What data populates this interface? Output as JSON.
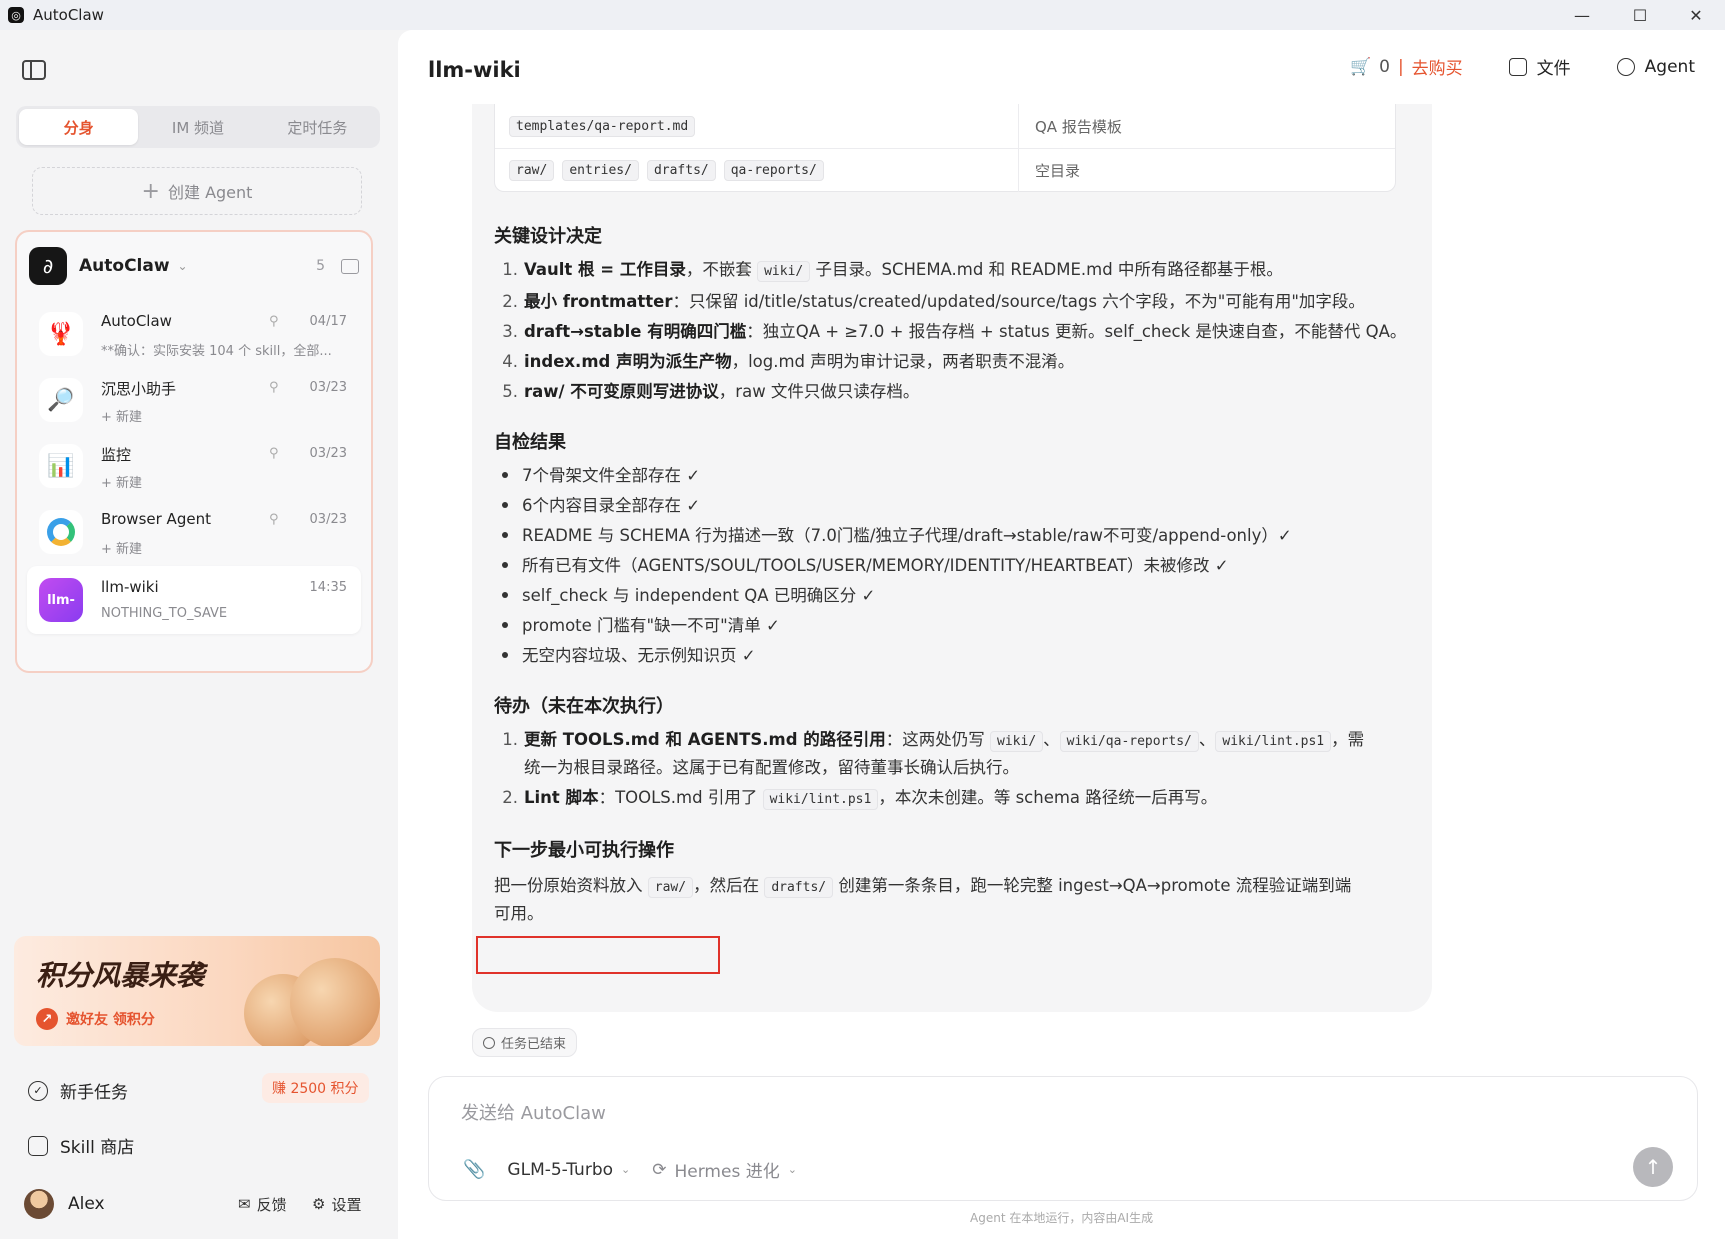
{
  "window": {
    "title": "AutoClaw",
    "minimize": "—",
    "maximize": "☐",
    "close": "✕"
  },
  "sidebar": {
    "tabs": [
      {
        "label": "分身",
        "active": true
      },
      {
        "label": "IM 频道",
        "active": false
      },
      {
        "label": "定时任务",
        "active": false
      }
    ],
    "create_agent": "创建 Agent",
    "group": {
      "name": "AutoClaw",
      "count": "5"
    },
    "agents": [
      {
        "name": "AutoClaw",
        "sub": "**确认：实际安装 104 个 skill，全部...",
        "date": "04/17",
        "pinned": true,
        "icon": "lobster-icon"
      },
      {
        "name": "沉思小助手",
        "sub": "+ 新建",
        "date": "03/23",
        "pinned": true,
        "icon": "magnifier-icon"
      },
      {
        "name": "监控",
        "sub": "+ 新建",
        "date": "03/23",
        "pinned": true,
        "icon": "chart-icon"
      },
      {
        "name": "Browser Agent",
        "sub": "+ 新建",
        "date": "03/23",
        "pinned": true,
        "icon": "browser-icon"
      },
      {
        "name": "llm-wiki",
        "sub": "NOTHING_TO_SAVE",
        "date": "14:35",
        "pinned": false,
        "avatar_text": "llm-"
      }
    ],
    "promo": {
      "title": "积分风暴来袭",
      "subtitle": "邀好友 领积分"
    },
    "links": {
      "novice": "新手任务",
      "earn": "赚 2500 积分",
      "skills": "Skill 商店"
    },
    "user": {
      "name": "Alex",
      "feedback": "反馈",
      "settings": "设置"
    }
  },
  "header": {
    "title": "llm-wiki",
    "cart_count": "0",
    "cart_sep": "|",
    "buy": "去购买",
    "files": "文件",
    "agent": "Agent"
  },
  "message": {
    "table": [
      {
        "codes": [
          "templates/qa-report.md"
        ],
        "desc": "QA 报告模板"
      },
      {
        "codes": [
          "raw/",
          "entries/",
          "drafts/",
          "qa-reports/"
        ],
        "desc": "空目录"
      }
    ],
    "design": {
      "heading": "关键设计决定",
      "items": [
        {
          "num": "1.",
          "bold": "Vault 根 = 工作目录",
          "pre": "，不嵌套 ",
          "code": "wiki/",
          "post": " 子目录。SCHEMA.md 和 README.md 中所有路径都基于根。"
        },
        {
          "num": "2.",
          "bold": "最小 frontmatter",
          "post": "：只保留 id/title/status/created/updated/source/tags 六个字段，不为\"可能有用\"加字段。"
        },
        {
          "num": "3.",
          "bold": "draft→stable 有明确四门槛",
          "post": "：独立QA + ≥7.0 + 报告存档 + status 更新。self_check 是快速自查，不能替代 QA。"
        },
        {
          "num": "4.",
          "bold": "index.md 声明为派生产物",
          "post": "，log.md 声明为审计记录，两者职责不混淆。"
        },
        {
          "num": "5.",
          "bold": "raw/ 不可变原则写进协议",
          "post": "，raw 文件只做只读存档。"
        }
      ]
    },
    "selfcheck": {
      "heading": "自检结果",
      "items": [
        "7个骨架文件全部存在 ✓",
        "6个内容目录全部存在 ✓",
        "README 与 SCHEMA 行为描述一致（7.0门槛/独立子代理/draft→stable/raw不可变/append-only）✓",
        "所有已有文件（AGENTS/SOUL/TOOLS/USER/MEMORY/IDENTITY/HEARTBEAT）未被修改 ✓",
        "self_check 与 independent QA 已明确区分 ✓",
        "promote 门槛有\"缺一不可\"清单 ✓",
        "无空内容垃圾、无示例知识页 ✓"
      ]
    },
    "todo": {
      "heading": "待办（未在本次执行）",
      "item1": {
        "num": "1.",
        "bold": "更新 TOOLS.md 和 AGENTS.md 的路径引用",
        "pre": "：这两处仍写 ",
        "codes": [
          "wiki/",
          "wiki/qa-reports/",
          "wiki/lint.ps1"
        ],
        "sep": "、",
        "post": "，需",
        "cont": "统一为根目录路径。这属于已有配置修改，留待董事长确认后执行。"
      },
      "item2": {
        "num": "2.",
        "bold": "Lint 脚本",
        "pre": "：TOOLS.md 引用了 ",
        "code": "wiki/lint.ps1",
        "post": "，本次未创建。等 schema 路径统一后再写。"
      }
    },
    "next": {
      "heading": "下一步最小可执行操作",
      "pre": "把一份原始资料放入 ",
      "code1": "raw/",
      "mid": "，然后在 ",
      "code2": "drafts/",
      "post": " 创建第一条条目，跑一轮完整 ingest→QA→promote 流程验证端到端",
      "cont": "可用。"
    },
    "status": "任务已结束"
  },
  "composer": {
    "placeholder": "发送给 AutoClaw",
    "model": "GLM-5-Turbo",
    "mode": "Hermes 进化",
    "footer": "Agent 在本地运行，内容由AI生成"
  },
  "colors": {
    "accent": "#e5542f",
    "highlight_border": "#e0322a"
  }
}
